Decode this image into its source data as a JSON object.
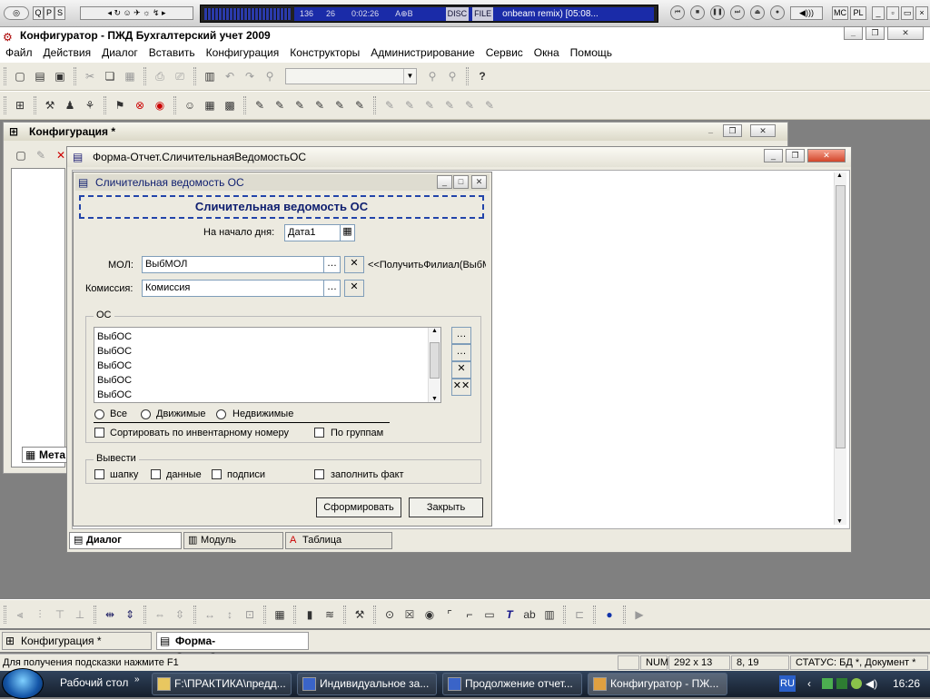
{
  "media_player": {
    "left_labels": [
      "Q",
      "P",
      "S"
    ],
    "counter_a": "136",
    "counter_b": "26",
    "time": "0:02:26",
    "eq_label": "A⊕B",
    "disc_label": "DISC",
    "file_label": "FILE",
    "track": "onbeam remix) [05:08...",
    "right_labels": [
      "MC",
      "PL"
    ]
  },
  "app": {
    "title": "Конфигуратор - ПЖД Бухгалтерский учет 2009",
    "menu": [
      "Файл",
      "Действия",
      "Диалог",
      "Вставить",
      "Конфигурация",
      "Конструкторы",
      "Администрирование",
      "Сервис",
      "Окна",
      "Помощь"
    ]
  },
  "config_window": {
    "title": "Конфигурация *",
    "tree_tab": "Мета"
  },
  "form_window": {
    "title": "Форма-Отчет.СличительнаяВедомостьОС"
  },
  "dialog": {
    "title": "Сличительная ведомость ОС",
    "header": "Сличительная ведомость ОС",
    "date_label": "На начало дня:",
    "date_value": "Дата1",
    "mol_label": "МОЛ:",
    "mol_value": "ВыбМОЛ",
    "branch_text": "<<ПолучитьФилиал(ВыбМ",
    "commission_label": "Комиссия:",
    "commission_value": "Комиссия",
    "group_os": "ОС",
    "os_list": [
      "ВыбОС",
      "ВыбОС",
      "ВыбОС",
      "ВыбОС",
      "ВыбОС"
    ],
    "radio_all": "Все",
    "radio_movable": "Движимые",
    "radio_immovable": "Недвижимые",
    "sort_label": "Сортировать по инвентарному номеру",
    "groups_label": "По группам",
    "group_output": "Вывести",
    "cb_header": "шапку",
    "cb_data": "данные",
    "cb_signatures": "подписи",
    "cb_fill_fact": "заполнить факт",
    "btn_form": "Сформировать",
    "btn_close": "Закрыть"
  },
  "tabs": [
    "Диалог",
    "Модуль",
    "Таблица"
  ],
  "window_tabs": [
    "Конфигурация *",
    "Форма-Отчет.Сличител..."
  ],
  "status": {
    "hint": "Для получения подсказки нажмите F1",
    "num": "NUM",
    "size": "292 x 13",
    "pos": "8, 19",
    "state": "СТАТУС: БД *, Документ *"
  },
  "taskbar": {
    "desktop": "Рабочий стол",
    "tasks": [
      "F:\\ПРАКТИКА\\предд...",
      "Индивидуальное за...",
      "Продолжение отчет...",
      "Конфигуратор - ПЖ..."
    ],
    "lang": "RU",
    "clock": "16:26"
  }
}
